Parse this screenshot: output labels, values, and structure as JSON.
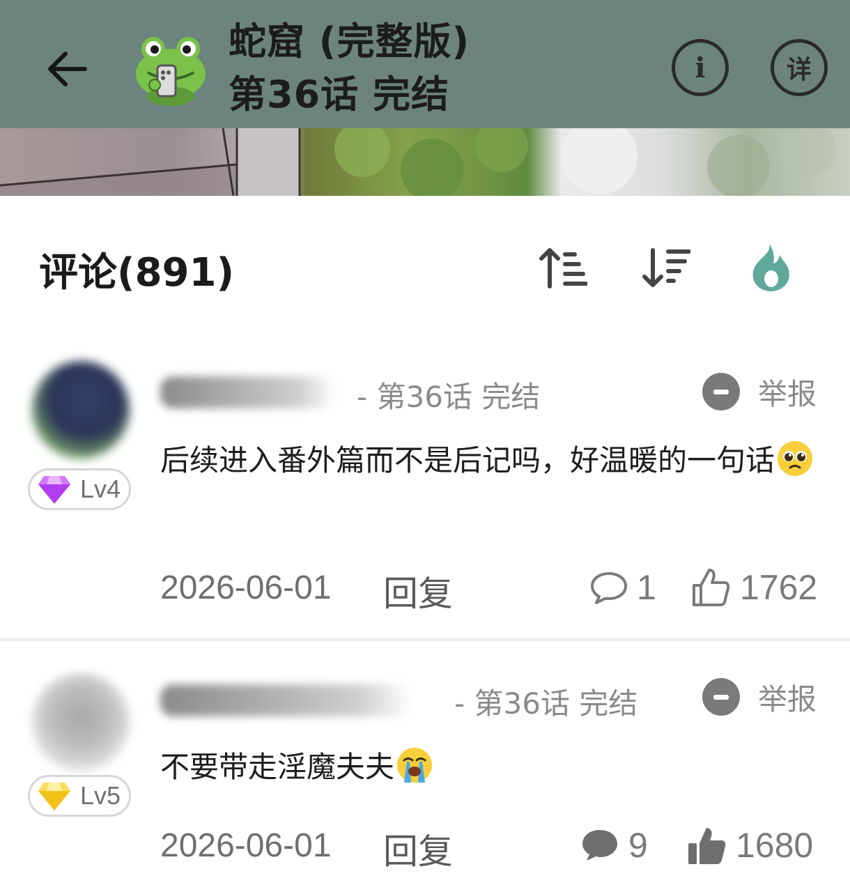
{
  "header": {
    "title": "蛇窟 (完整版)",
    "subtitle": "第36话 完结",
    "back_icon": "arrow-left-icon",
    "info_label": "i",
    "detail_label": "详",
    "background_color": "#6c847d"
  },
  "comments_section": {
    "title": "评论(891)",
    "sort_ascending_icon": "sort-ascending-icon",
    "sort_descending_icon": "sort-descending-icon",
    "hot_icon": "flame-icon",
    "accent_color": "#5fa89a"
  },
  "comments": [
    {
      "level": "Lv4",
      "gem_color": "#b23cf0",
      "chapter": "- 第36话  完结",
      "report_label": "举报",
      "text": "后续进入番外篇而不是后记吗，好温暖的一句话",
      "emoji": "pleading-face-emoji",
      "date": "2026-06-01",
      "reply_label": "回复",
      "reply_count": "1",
      "like_count": "1762",
      "liked": false
    },
    {
      "level": "Lv5",
      "gem_color": "#f2c21a",
      "chapter": "- 第36话  完结",
      "report_label": "举报",
      "text": "不要带走淫魔夫夫",
      "emoji": "loudly-crying-face-emoji",
      "date": "2026-06-01",
      "reply_label": "回复",
      "reply_count": "9",
      "like_count": "1680",
      "liked": true
    }
  ]
}
